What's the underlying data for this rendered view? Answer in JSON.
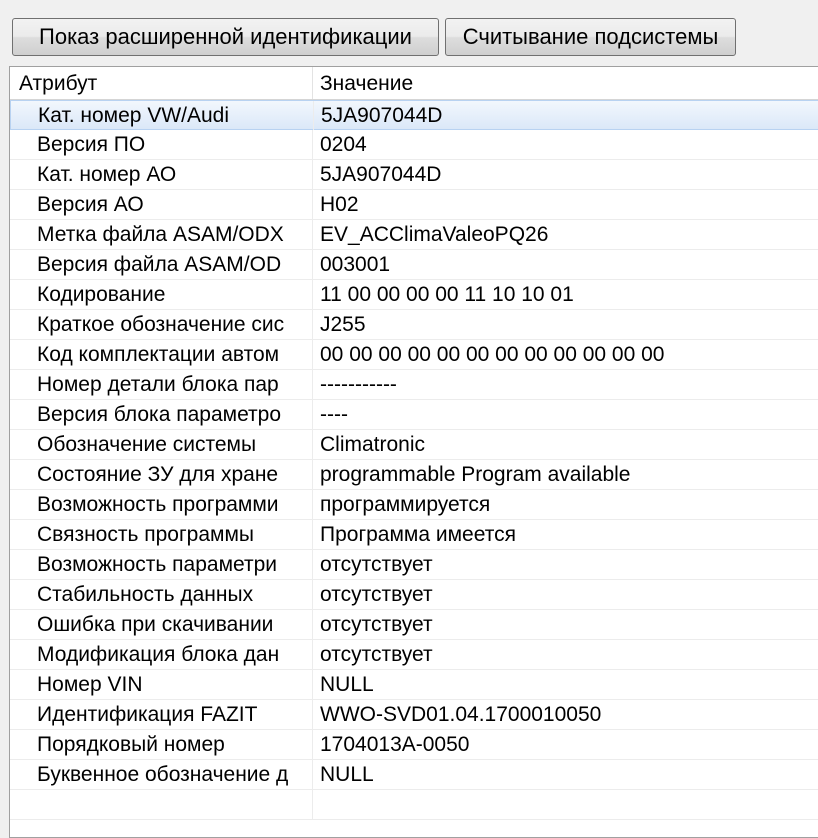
{
  "toolbar": {
    "extended_id_button": "Показ расширенной идентификации",
    "read_subsystem_button": "Считывание подсистемы"
  },
  "table": {
    "columns": {
      "attribute": "Атрибут",
      "value": "Значение"
    },
    "rows": [
      {
        "attribute": "Кат. номер VW/Audi",
        "value": "5JA907044D",
        "selected": true
      },
      {
        "attribute": "Версия ПО",
        "value": "0204"
      },
      {
        "attribute": "Кат. номер АО",
        "value": "5JA907044D"
      },
      {
        "attribute": "Версия АО",
        "value": "H02"
      },
      {
        "attribute": "Метка файла ASAM/ODX",
        "value": "EV_ACClimaValeoPQ26"
      },
      {
        "attribute": "Версия файла ASAM/OD",
        "value": "003001"
      },
      {
        "attribute": "Кодирование",
        "value": "11 00 00 00 00 11 10 10 01"
      },
      {
        "attribute": "Краткое обозначение сис",
        "value": "J255"
      },
      {
        "attribute": "Код комплектации автом",
        "value": "00 00 00 00 00 00 00 00 00 00 00 00"
      },
      {
        "attribute": "Номер детали блока пар",
        "value": "-----------"
      },
      {
        "attribute": "Версия блока параметро",
        "value": "----"
      },
      {
        "attribute": "Обозначение системы",
        "value": "Climatronic"
      },
      {
        "attribute": "Состояние ЗУ для хране",
        "value": "programmable Program available"
      },
      {
        "attribute": "Возможность программи",
        "value": "программируется"
      },
      {
        "attribute": "Связность программы",
        "value": "Программа имеется"
      },
      {
        "attribute": "Возможность параметри",
        "value": "отсутствует"
      },
      {
        "attribute": "Стабильность данных",
        "value": "отсутствует"
      },
      {
        "attribute": "Ошибка при скачивании",
        "value": "отсутствует"
      },
      {
        "attribute": "Модификация блока дан",
        "value": "отсутствует"
      },
      {
        "attribute": "Номер VIN",
        "value": "NULL"
      },
      {
        "attribute": "Идентификация FAZIT",
        "value": "WWO-SVD01.04.1700010050"
      },
      {
        "attribute": "Порядковый номер",
        "value": " 1704013A-0050"
      },
      {
        "attribute": "Буквенное обозначение д",
        "value": "NULL"
      },
      {
        "attribute": "",
        "value": ""
      }
    ]
  }
}
